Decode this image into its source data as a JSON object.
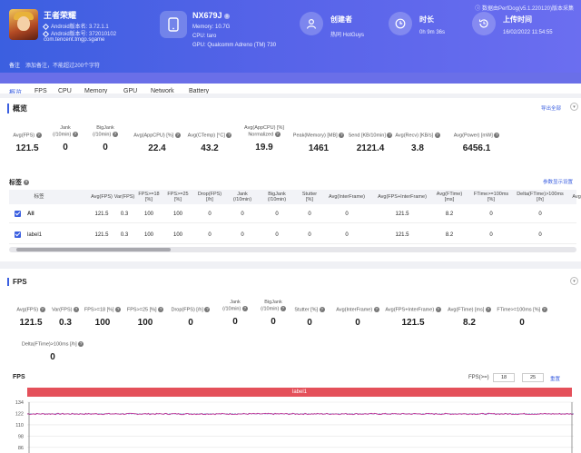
{
  "header": {
    "app": {
      "name": "王者荣耀",
      "android_version": "Android版本名: 3.72.1.1",
      "android_code": "Android版本号: 372010102",
      "package": "com.tencent.tmgp.sgame"
    },
    "device": {
      "name": "NX679J",
      "memory": "Memory: 10.7G",
      "cpu": "CPU: taro",
      "gpu": "GPU: Qualcomm Adreno (TM) 730"
    },
    "creator": {
      "label": "创建者",
      "value": "热同 HotGuys"
    },
    "duration": {
      "label": "时长",
      "value": "0h 9m 36s"
    },
    "upload": {
      "label": "上传时间",
      "value": "16/02/2022 11:54:55"
    },
    "version_note": "数据由PerfDog(v5.1.220120)版本采集",
    "notes": {
      "label": "备注",
      "placeholder": "添加备注，不能超过200个字符"
    }
  },
  "tabs": [
    "概览",
    "FPS",
    "CPU",
    "Memory",
    "GPU",
    "Network",
    "Battery"
  ],
  "overview": {
    "title": "概览",
    "export": "导出全部",
    "metrics": [
      {
        "label": "Avg(FPS)",
        "value": "121.5"
      },
      {
        "label": "Jank\n(/10min)",
        "value": "0"
      },
      {
        "label": "BigJank\n(/10min)",
        "value": "0"
      },
      {
        "label": "Avg(AppCPU) [%]",
        "value": "22.4"
      },
      {
        "label": "Avg(CTemp) [°C]",
        "value": "43.2"
      },
      {
        "label": "Avg(AppCPU) [%]\nNormalized",
        "value": "19.9"
      },
      {
        "label": "Peak(Memory) [MB]",
        "value": "1461"
      },
      {
        "label": "Send [KB/10min]",
        "value": "2121.4"
      },
      {
        "label": "Avg(Recv) [KB/s]",
        "value": "3.8"
      },
      {
        "label": "Avg(Power) [mW]",
        "value": "6456.1"
      }
    ]
  },
  "labels_table": {
    "title": "标签",
    "settings": "参数显示设置",
    "headers": [
      "标签",
      "Avg(FPS)",
      "Var(FPS)",
      "FPS>=18\n[%]",
      "FPS>=25\n[%]",
      "Drop(FPS)\n[/h]",
      "Jank\n(/10min)",
      "BigJank\n(/10min)",
      "Stutter\n[%]",
      "Avg(InterFrame)",
      "Avg(FPS+InterFrame)",
      "Avg(FTime)\n[ms]",
      "FTime>=100ms\n[%]",
      "Delta(FTime)>100ms\n[/h]",
      "Avg("
    ],
    "rows": [
      [
        "All",
        "121.5",
        "0.3",
        "100",
        "100",
        "0",
        "0",
        "0",
        "0",
        "0",
        "121.5",
        "8.2",
        "0",
        "0",
        ""
      ],
      [
        "label1",
        "121.5",
        "0.3",
        "100",
        "100",
        "0",
        "0",
        "0",
        "0",
        "0",
        "121.5",
        "8.2",
        "0",
        "0",
        ""
      ]
    ]
  },
  "fps_section": {
    "title": "FPS",
    "metrics": [
      {
        "label": "Avg(FPS)",
        "value": "121.5"
      },
      {
        "label": "Var(FPS)",
        "value": "0.3"
      },
      {
        "label": "FPS>=18 [%]",
        "value": "100"
      },
      {
        "label": "FPS>=25 [%]",
        "value": "100"
      },
      {
        "label": "Drop(FPS) [/h]",
        "value": "0"
      },
      {
        "label": "Jank\n(/10min)",
        "value": "0"
      },
      {
        "label": "BigJank\n(/10min)",
        "value": "0"
      },
      {
        "label": "Stutter [%]",
        "value": "0"
      },
      {
        "label": "Avg(InterFrame)",
        "value": "0"
      },
      {
        "label": "Avg(FPS+InterFrame)",
        "value": "121.5"
      },
      {
        "label": "Avg(FTime) [ms]",
        "value": "8.2"
      },
      {
        "label": "FTime>=100ms [%]",
        "value": "0"
      },
      {
        "label": "Delta(FTime)>100ms [/h]",
        "value": "0"
      }
    ]
  },
  "fps_chart": {
    "label": "FPS",
    "filter_label": "FPS(>=)",
    "filter_values": [
      "18",
      "25"
    ],
    "reset": "重置",
    "series_label": "label1"
  },
  "chart_data": {
    "type": "line",
    "title": "FPS",
    "y_ticks": [
      134,
      122,
      110,
      98,
      86
    ],
    "ylim": [
      80,
      134
    ],
    "series": [
      {
        "name": "label1",
        "color": "#c0399a",
        "mean": 121.5,
        "values_note": ""
      }
    ],
    "colors": {
      "band": "#e4505a",
      "line": "#c0399a",
      "avg_line": "#5b8ed9"
    }
  }
}
